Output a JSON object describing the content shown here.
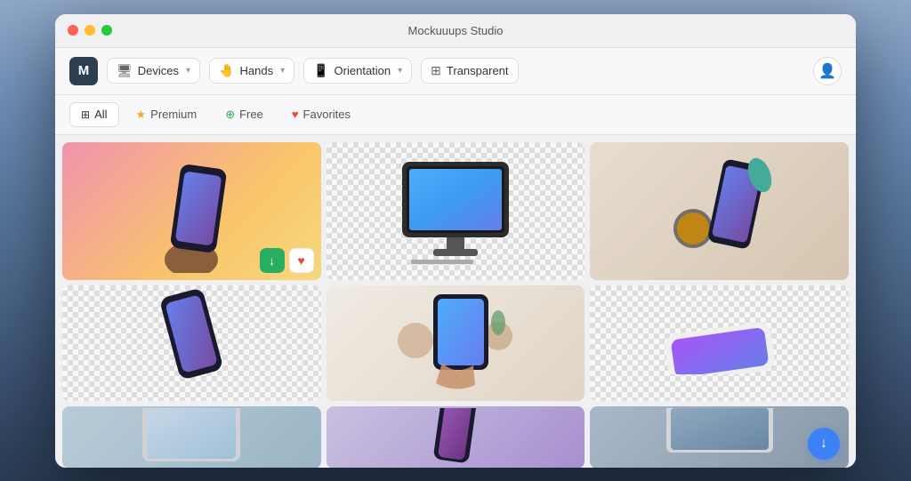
{
  "window": {
    "title": "Mockuuups Studio",
    "traffic_lights": [
      "close",
      "minimize",
      "maximize"
    ]
  },
  "toolbar": {
    "logo_label": "M",
    "devices_label": "Devices",
    "hands_label": "Hands",
    "orientation_label": "Orientation",
    "transparent_label": "Transparent"
  },
  "filter_tabs": [
    {
      "id": "all",
      "label": "All",
      "icon": "grid",
      "active": true
    },
    {
      "id": "premium",
      "label": "Premium",
      "icon": "star",
      "active": false
    },
    {
      "id": "free",
      "label": "Free",
      "icon": "circle-check",
      "active": false
    },
    {
      "id": "favorites",
      "label": "Favorites",
      "icon": "heart",
      "active": false
    }
  ],
  "grid_items": [
    {
      "id": 1,
      "type": "phone-hand",
      "bg": "gradient-pink",
      "span": "large"
    },
    {
      "id": 2,
      "type": "monitor",
      "bg": "checker"
    },
    {
      "id": 3,
      "type": "phone-coffee",
      "bg": "photo"
    },
    {
      "id": 4,
      "type": "phone-tilted",
      "bg": "checker"
    },
    {
      "id": 5,
      "type": "ipad-hand",
      "bg": "photo"
    },
    {
      "id": 6,
      "type": "phone-horizontal",
      "bg": "checker"
    },
    {
      "id": 7,
      "type": "macbook-partial",
      "bg": "teal"
    },
    {
      "id": 8,
      "type": "phone-partial",
      "bg": "purple"
    },
    {
      "id": 9,
      "type": "laptop-partial",
      "bg": "blue-gray"
    }
  ],
  "fab": {
    "icon": "download",
    "color": "#3b82f6"
  }
}
